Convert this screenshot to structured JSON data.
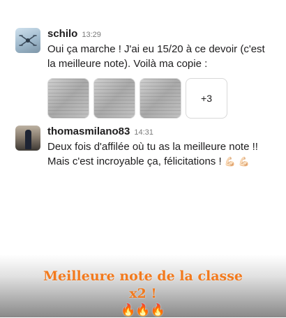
{
  "messages": [
    {
      "author": "schilo",
      "time": "13:29",
      "lines": [
        "Oui ça marche ! J'ai eu 15/20 à ce devoir (c'est",
        "la meilleure note). Voilà ma copie :"
      ],
      "more_attachments": "+3"
    },
    {
      "author": "thomasmilano83",
      "time": "14:31",
      "lines": [
        "Deux fois d'affilée où tu as la meilleure note !!",
        "Mais c'est incroyable ça, félicitations !"
      ],
      "emoji": "💪🏻 💪🏻"
    }
  ],
  "overlay": {
    "line1": "Meilleure note de la classe",
    "line2": "x2 !",
    "emoji": "🔥🔥🔥"
  }
}
